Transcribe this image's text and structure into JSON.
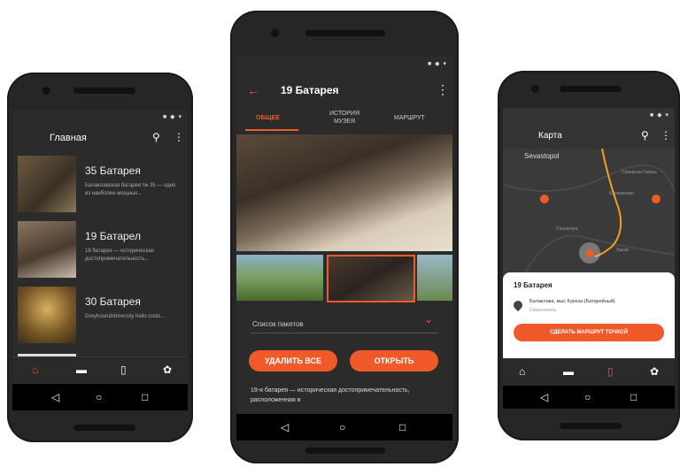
{
  "colors": {
    "accent": "#f05a28",
    "background": "#2b2b2b"
  },
  "status_icons": "■ ◆ ▾",
  "nav": {
    "back": "◁",
    "home": "○",
    "recent": "□"
  },
  "left": {
    "title": "Главная",
    "search_icon": "⚲",
    "menu_icon": "⋮",
    "items": [
      {
        "title": "35 Батарея",
        "desc": "Балаклавская батарея № 35 — одно из наиболее мощных..."
      },
      {
        "title": "19 Батарел",
        "desc": "19 батарея — историческая достопримечательность..."
      },
      {
        "title": "30 Батарея",
        "desc": "Greyhound/driversity hello cools..."
      }
    ],
    "bottom_nav": {
      "home": "⌂",
      "folder": "▬",
      "map": "▯",
      "settings": "✿"
    }
  },
  "center": {
    "back_icon": "←",
    "title": "19 Батарея",
    "menu_icon": "⋮",
    "tabs": [
      "ОБЩЕЕ",
      "ИСТОРИЯ МУЗЕЯ",
      "МАРШРУТ"
    ],
    "list_label": "Список пакетов",
    "chevron": "⌄",
    "btn_delete": "УДАЛИТЬ ВСЕ",
    "btn_open": "ОТКРЫТЬ",
    "description": "19-я батарея — историческая достопримечательность, расположенная в"
  },
  "right": {
    "title": "Карта",
    "search_icon": "⚲",
    "menu_icon": "⋮",
    "map_city": "Sevastopol",
    "map_labels": [
      "Северная Гавань",
      "Караимская",
      "Сапунгора",
      "Ласпи"
    ],
    "card_title": "19 Батарея",
    "card_address": "Балаклава, мыс Куреза (Батарейный)",
    "card_sub": "Севастополь",
    "card_button": "СДЕЛАТЬ МАРШРУТ ТОЧКОЙ",
    "bottom_nav": {
      "home": "⌂",
      "folder": "▬",
      "map": "▯",
      "settings": "✿"
    }
  }
}
